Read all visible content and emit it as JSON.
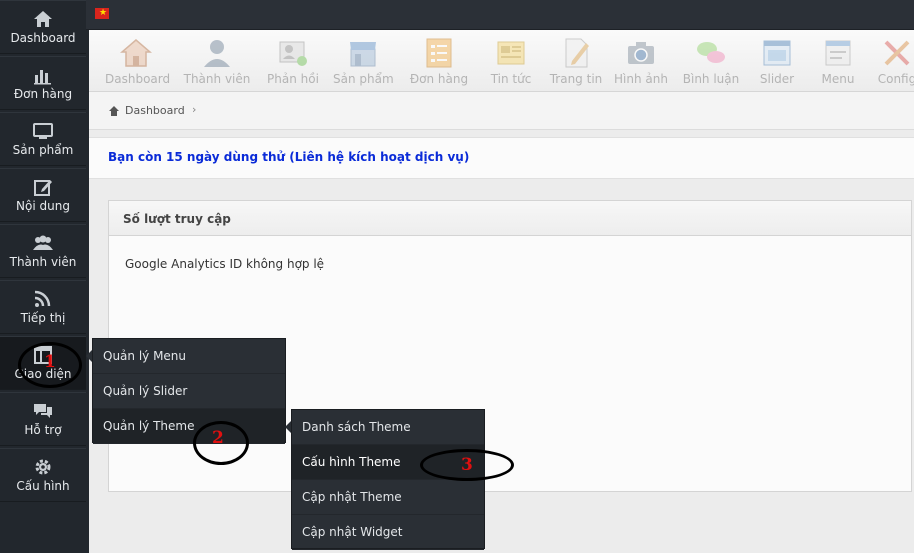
{
  "sidebar": {
    "items": [
      {
        "label": "Dashboard",
        "icon": "home-icon"
      },
      {
        "label": "Đơn hàng",
        "icon": "bar-chart-icon"
      },
      {
        "label": "Sản phẩm",
        "icon": "monitor-icon"
      },
      {
        "label": "Nội dung",
        "icon": "edit-icon"
      },
      {
        "label": "Thành viên",
        "icon": "users-icon"
      },
      {
        "label": "Tiếp thị",
        "icon": "rss-icon"
      },
      {
        "label": "Giao diện",
        "icon": "layout-icon"
      },
      {
        "label": "Hỗ trợ",
        "icon": "chat-icon"
      },
      {
        "label": "Cấu hình",
        "icon": "gear-icon"
      }
    ]
  },
  "topbar": {
    "flag": "vietnam-flag-icon"
  },
  "toolbar": {
    "items": [
      {
        "label": "Dashboard",
        "icon": "house-icon"
      },
      {
        "label": "Thành viên",
        "icon": "user-icon"
      },
      {
        "label": "Phản hồi",
        "icon": "feedback-icon"
      },
      {
        "label": "Sản phẩm",
        "icon": "store-icon"
      },
      {
        "label": "Đơn hàng",
        "icon": "order-list-icon"
      },
      {
        "label": "Tin tức",
        "icon": "news-icon"
      },
      {
        "label": "Trang tin",
        "icon": "page-icon"
      },
      {
        "label": "Hình ảnh",
        "icon": "camera-icon"
      },
      {
        "label": "Bình luận",
        "icon": "comments-icon"
      },
      {
        "label": "Slider",
        "icon": "slider-icon"
      },
      {
        "label": "Menu",
        "icon": "menu-icon"
      },
      {
        "label": "Config",
        "icon": "tools-icon"
      }
    ]
  },
  "breadcrumb": {
    "home": "Dashboard",
    "separator": "›"
  },
  "notice": {
    "text": "Bạn còn 15 ngày dùng thử (Liên hệ kích hoạt dịch vụ)"
  },
  "panel": {
    "title": "Số lượt truy cập",
    "body": "Google Analytics ID không hợp lệ"
  },
  "menu_giao_dien": {
    "items": [
      "Quản lý Menu",
      "Quản lý Slider",
      "Quản lý Theme"
    ]
  },
  "menu_theme": {
    "items": [
      "Danh sách Theme",
      "Cấu hình Theme",
      "Cập nhật Theme",
      "Cập nhật Widget"
    ]
  },
  "annotations": {
    "one": "1",
    "two": "2",
    "three": "3"
  },
  "colors": {
    "notice_text": "#0a2bd8",
    "annotation_number": "#e01010",
    "sidebar_bg": "#22272d"
  }
}
